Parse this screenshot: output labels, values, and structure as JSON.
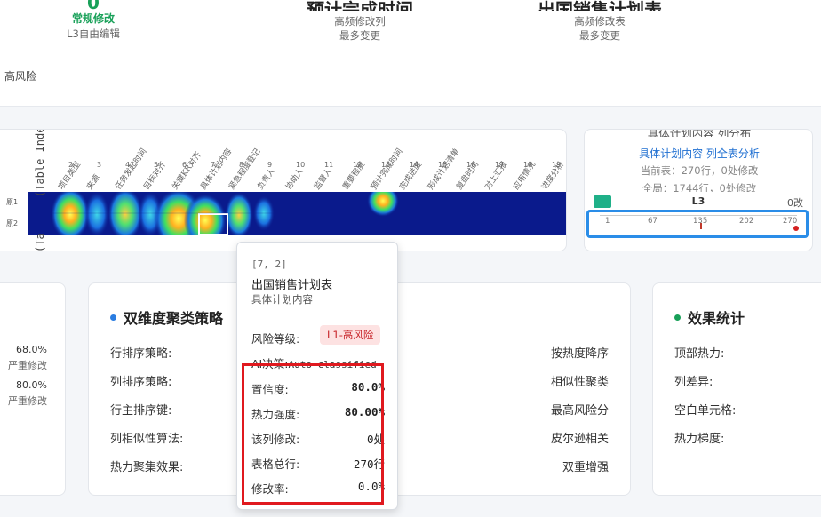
{
  "top": {
    "col1": {
      "number": "0",
      "label": "常规修改",
      "sub": "L3自由编辑"
    },
    "col2": {
      "title": "预计完成时间",
      "sub1": "高频修改列",
      "sub2": "最多变更"
    },
    "col3": {
      "title": "出国销售计划表",
      "sub1": "高频修改表",
      "sub2": "最多变更"
    },
    "high_risk": "高风险"
  },
  "heatmap": {
    "y_axis_label": "(Table Index) - 按",
    "x_axis_hint": "(Ta",
    "row_labels": [
      "原1",
      "原2"
    ],
    "columns": [
      {
        "num": "2",
        "name": "项目类型"
      },
      {
        "num": "3",
        "name": "来源"
      },
      {
        "num": "4",
        "name": "任务发起时间"
      },
      {
        "num": "5",
        "name": "目标对齐"
      },
      {
        "num": "6",
        "name": "关键KR对齐"
      },
      {
        "num": "7",
        "name": "具体计划内容"
      },
      {
        "num": "8",
        "name": "紧急程度登记"
      },
      {
        "num": "9",
        "name": "负责人"
      },
      {
        "num": "10",
        "name": "协助人"
      },
      {
        "num": "11",
        "name": "监督人"
      },
      {
        "num": "12",
        "name": "重要程度"
      },
      {
        "num": "13",
        "name": "预计完成时间"
      },
      {
        "num": "14",
        "name": "完成进度"
      },
      {
        "num": "15",
        "name": "形成计划清单"
      },
      {
        "num": "16",
        "name": "复盘时间"
      },
      {
        "num": "17",
        "name": "对上汇报"
      },
      {
        "num": "18",
        "name": "应用情况"
      },
      {
        "num": "19",
        "name": "进度分析"
      }
    ]
  },
  "mini": {
    "title": "具体计划内容 列分布",
    "link": "具体计划内容 列全表分析",
    "current": "当前表：270行，0处修改",
    "global": "全局：1744行，0处修改",
    "level": "L3",
    "changes": "0改",
    "ticks": [
      "1",
      "67",
      "135",
      "202",
      "270"
    ]
  },
  "cards": {
    "left": {
      "v1": "68.0%",
      "s1": "严重修改",
      "v2": "80.0%",
      "s2": "严重修改"
    },
    "middle": {
      "title": "双维度聚类策略",
      "rows": [
        {
          "label": "行排序策略:",
          "value": "按热度降序"
        },
        {
          "label": "列排序策略:",
          "value": "相似性聚类"
        },
        {
          "label": "行主排序键:",
          "value": "最高风险分"
        },
        {
          "label": "列相似性算法:",
          "value": "皮尔逊相关"
        },
        {
          "label": "热力聚集效果:",
          "value": "双重增强"
        }
      ]
    },
    "right": {
      "title": "效果统计",
      "rows": [
        {
          "label": "顶部热力:"
        },
        {
          "label": "列差异:"
        },
        {
          "label": "空白单元格:"
        },
        {
          "label": "热力梯度:"
        }
      ]
    }
  },
  "tooltip": {
    "coord": "[7, 2]",
    "title": "出国销售计划表",
    "subtitle": "具体计划内容",
    "risk_label": "风险等级:",
    "risk_value": "L1-高风险",
    "ai_label": "AI决策:",
    "ai_value": "Auto-classified",
    "rows": [
      {
        "label": "置信度:",
        "value": "80.0%"
      },
      {
        "label": "热力强度:",
        "value": "80.00%"
      },
      {
        "label": "该列修改:",
        "value": "0处"
      },
      {
        "label": "表格总行:",
        "value": "270行"
      },
      {
        "label": "修改率:",
        "value": "0.0%"
      }
    ]
  },
  "colors": {
    "accent_blue": "#1f6fd1",
    "green": "#18a058",
    "risk_red": "#c8262b",
    "highlight_box": "#e0191f",
    "heat_base": "#0a1a8c"
  }
}
